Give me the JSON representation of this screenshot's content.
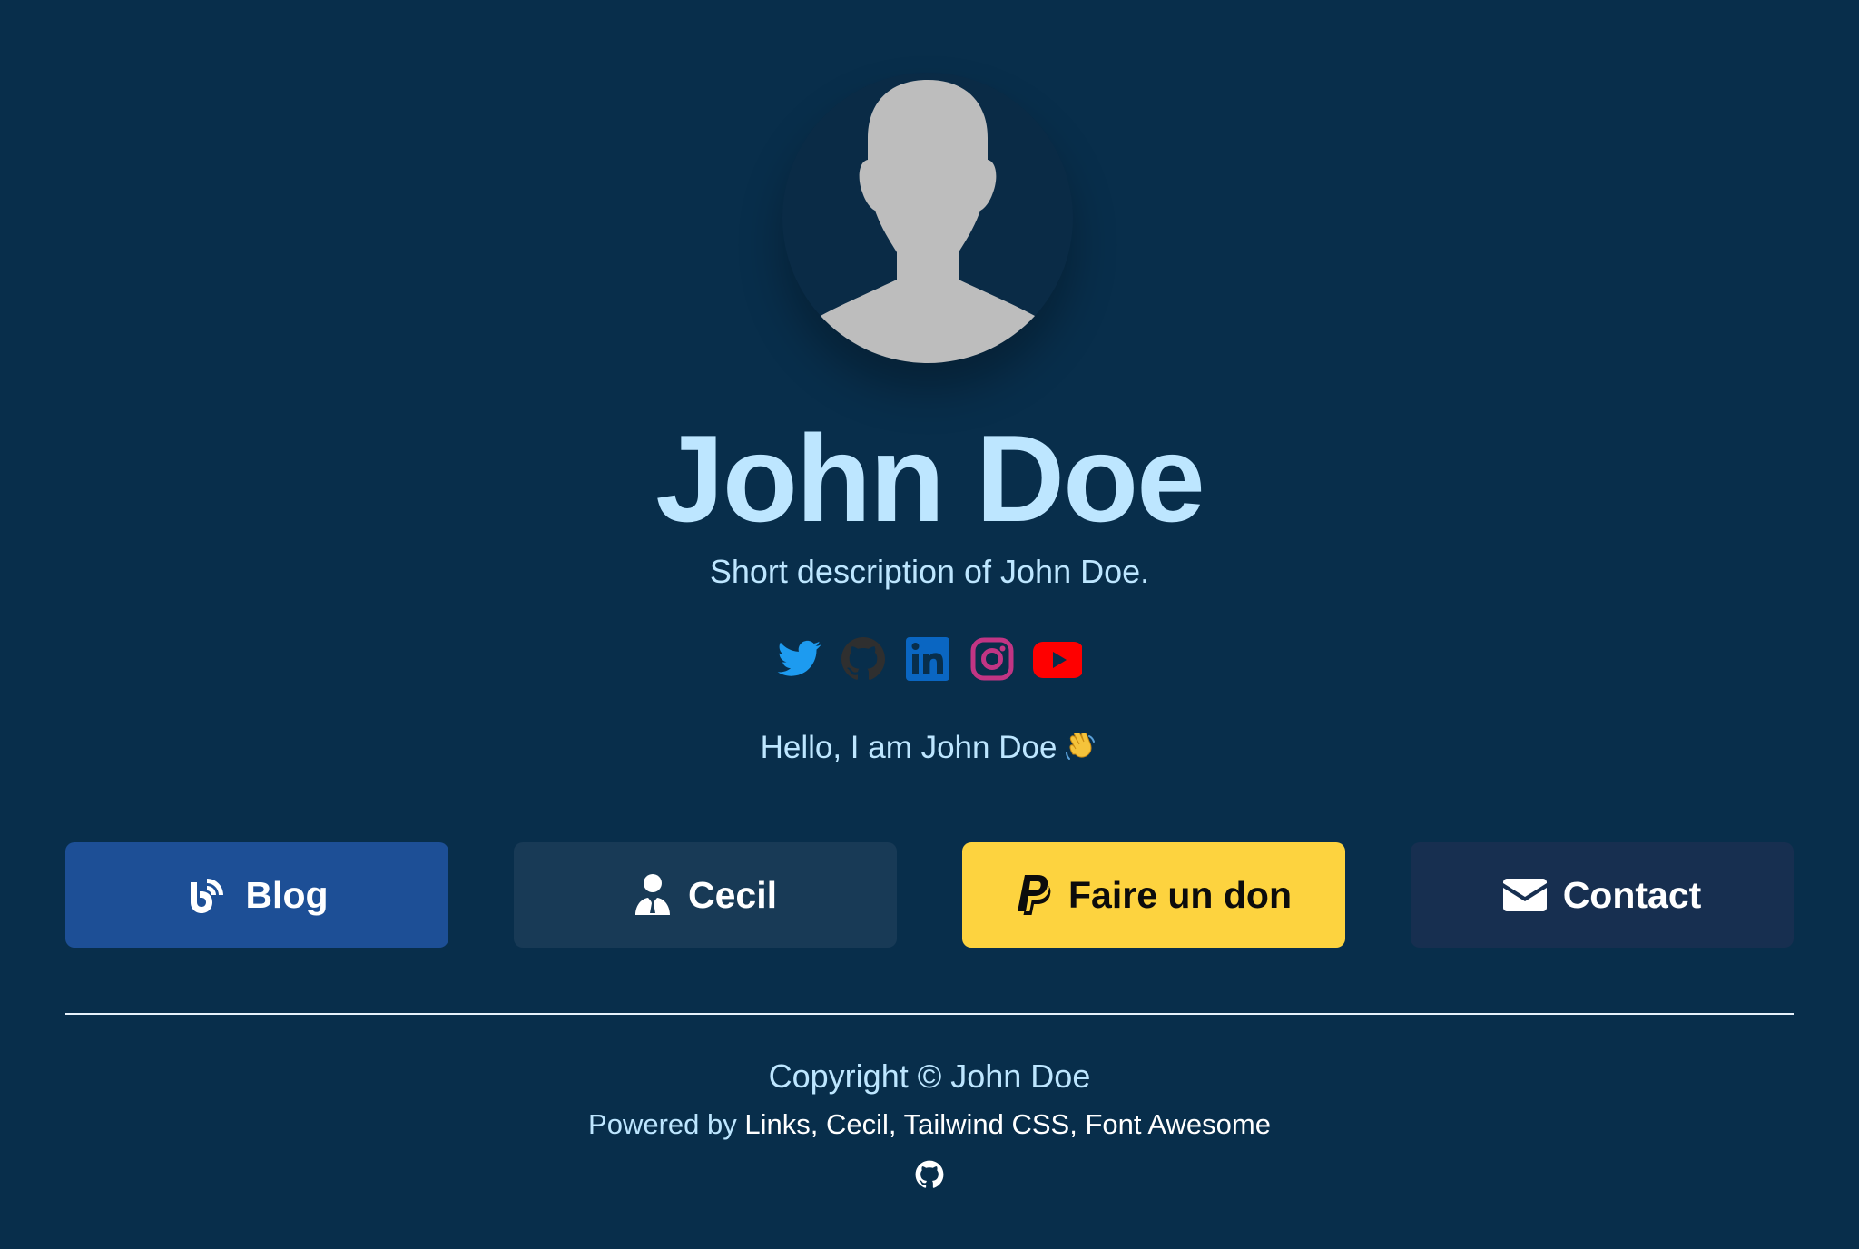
{
  "profile": {
    "name": "John Doe",
    "description": "Short description of John Doe.",
    "greeting": "Hello, I am John Doe",
    "greeting_emoji": "waving-hand-icon"
  },
  "social": [
    {
      "name": "twitter",
      "icon": "twitter-icon",
      "color": "#1d9bf0"
    },
    {
      "name": "github",
      "icon": "github-icon",
      "color": "#2f2f2f"
    },
    {
      "name": "linkedin",
      "icon": "linkedin-icon",
      "color": "#0a66c2"
    },
    {
      "name": "instagram",
      "icon": "instagram-icon",
      "color": "#c13584"
    },
    {
      "name": "youtube",
      "icon": "youtube-icon",
      "color": "#ff0000"
    }
  ],
  "buttons": {
    "blog": {
      "label": "Blog",
      "icon": "blog-icon",
      "color": "#1d4f96"
    },
    "cecil": {
      "label": "Cecil",
      "icon": "user-tie-icon",
      "color": "#183a56"
    },
    "donate": {
      "label": "Faire un don",
      "icon": "paypal-icon",
      "color": "#fdd33f"
    },
    "contact": {
      "label": "Contact",
      "icon": "envelope-icon",
      "color": "#172f50"
    }
  },
  "footer": {
    "copyright": "Copyright © John Doe",
    "powered_prefix": "Powered by",
    "links": [
      "Links",
      "Cecil",
      "Tailwind CSS",
      "Font Awesome"
    ],
    "separator": ",",
    "icon": "github-icon"
  },
  "colors": {
    "background": "#082e4b",
    "text": "#bde6ff"
  }
}
